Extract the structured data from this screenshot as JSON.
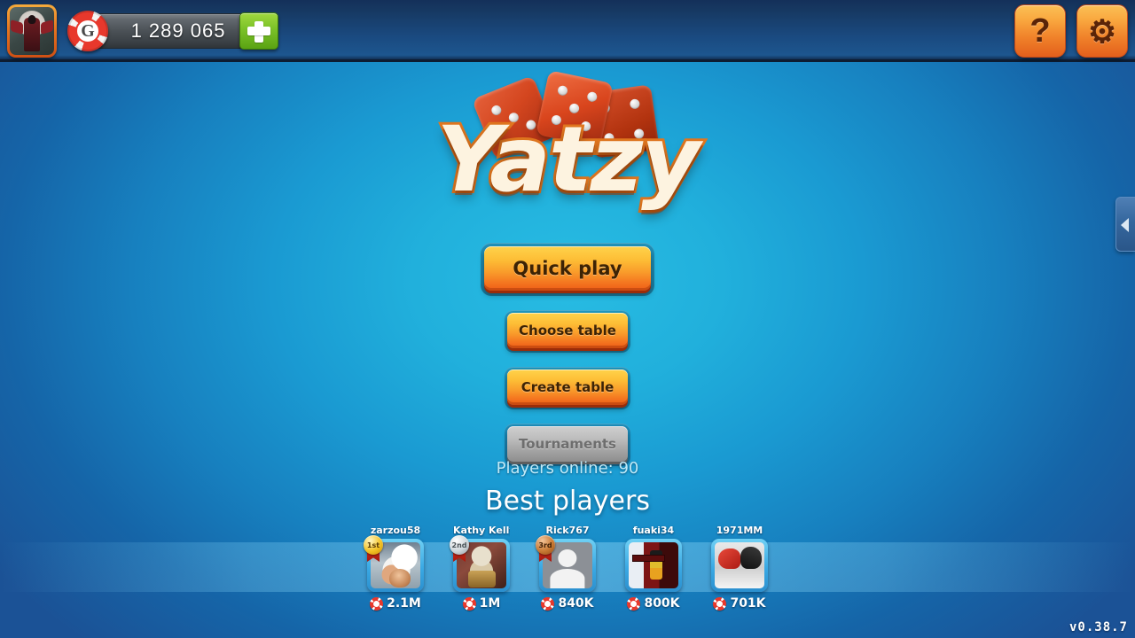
{
  "app": {
    "title": "Yatzy",
    "version_label": "v0.38.7"
  },
  "topbar": {
    "profile_icon": "player-avatar-icon",
    "currency": {
      "chip_icon": "red-poker-chip-icon",
      "chip_letter": "G",
      "amount": "1 289 065",
      "add_button_icon": "plus-icon",
      "add_button_label": "+"
    },
    "help_button": {
      "icon": "question-mark-icon",
      "label": "?"
    },
    "settings_button": {
      "icon": "gear-icon",
      "label": "⚙"
    }
  },
  "logo": {
    "text": "Yatzy",
    "dice_icon": "three-dice-icon"
  },
  "menu": {
    "quick_play": "Quick play",
    "choose_table": "Choose table",
    "create_table": "Create table",
    "tournaments": "Tournaments",
    "tournaments_disabled": true
  },
  "status": {
    "players_online": "Players online: 90",
    "best_players_title": "Best players"
  },
  "best_players": [
    {
      "name": "zarzou58",
      "score": "2.1M",
      "medal": "gold",
      "medal_label": "1st",
      "avatar": "av-bear",
      "avatar_icon": "polar-bear-photo-avatar"
    },
    {
      "name": "Kathy Kelly Mee...",
      "score": "1M",
      "medal": "silver",
      "medal_label": "2nd",
      "avatar": "av-dog",
      "avatar_icon": "dog-photo-avatar"
    },
    {
      "name": "Rick767",
      "score": "840K",
      "medal": "bronze",
      "medal_label": "3rd",
      "avatar": "av-person",
      "avatar_icon": "default-person-avatar"
    },
    {
      "name": "fuaki34",
      "score": "800K",
      "medal": "",
      "medal_label": "",
      "avatar": "av-anime",
      "avatar_icon": "anime-character-avatar"
    },
    {
      "name": "1971MM",
      "score": "701K",
      "medal": "",
      "medal_label": "",
      "avatar": "av-penguin",
      "avatar_icon": "photo-avatar"
    }
  ],
  "side_panel_tab": {
    "icon": "chevron-left-icon"
  },
  "colors": {
    "bg_center": "#21b0dc",
    "bg_edge": "#1b5296",
    "topbar_dark": "#14305a",
    "button_gold_top": "#ffd34b",
    "button_gold_bottom": "#ee5b17",
    "button_disabled": "#bdbdbd",
    "accent_green": "#7ec42a",
    "chip_red": "#e8382c",
    "frame_blue": "#3aa9e4"
  }
}
